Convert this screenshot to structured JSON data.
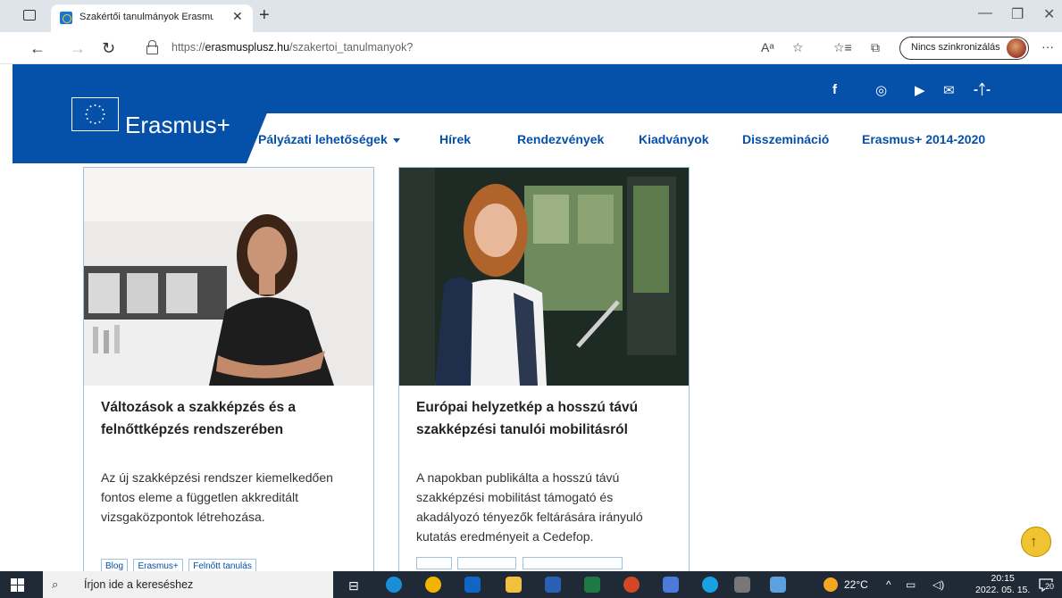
{
  "browser": {
    "tab_title": "Szakértői tanulmányok Erasmus+",
    "tab_close": "✕",
    "new_tab": "+",
    "url_prefix": "https://",
    "url_domain": "erasmusplusz.hu",
    "url_path": "/szakertoi_tanulmanyok?",
    "sync_label": "Nincs szinkronizálás",
    "read_aloud": "Aᵃ",
    "more": "···"
  },
  "site": {
    "logo_text": "Erasmus+",
    "nav": [
      {
        "label": "Pályázati lehetőségek"
      },
      {
        "label": "Hírek"
      },
      {
        "label": "Rendezvények"
      },
      {
        "label": "Kiadványok"
      },
      {
        "label": "Disszemináció"
      },
      {
        "label": "Erasmus+ 2014-2020"
      }
    ],
    "social_icons": [
      "facebook-icon",
      "instagram-icon",
      "youtube-icon",
      "mail-icon",
      "accessibility-icon"
    ]
  },
  "cards": [
    {
      "title": "Változások a szakképzés és a felnőttképzés rendszerében",
      "text": "Az új szakképzési rendszer kiemelkedően fontos eleme a független akkreditált vizsgaközpontok létrehozása.",
      "tags": [
        "Blog",
        "Erasmus+",
        "Felnőtt tanulás"
      ]
    },
    {
      "title": "Európai helyzetkép a hosszú távú szakképzési tanulói mobilitásról",
      "text": "A napokban publikálta a hosszú távú szakképzési mobilitást támogató és akadályozó tényezők feltárására irányuló kutatás eredményeit a Cedefop."
    }
  ],
  "taskbar": {
    "search_placeholder": "Írjon ide a kereséshez",
    "temperature": "22°C",
    "time": "20:15",
    "date": "2022. 05. 15.",
    "notifications": "20"
  },
  "colors": {
    "brand_blue": "#0550a8",
    "scroll_button": "#f1c232"
  }
}
